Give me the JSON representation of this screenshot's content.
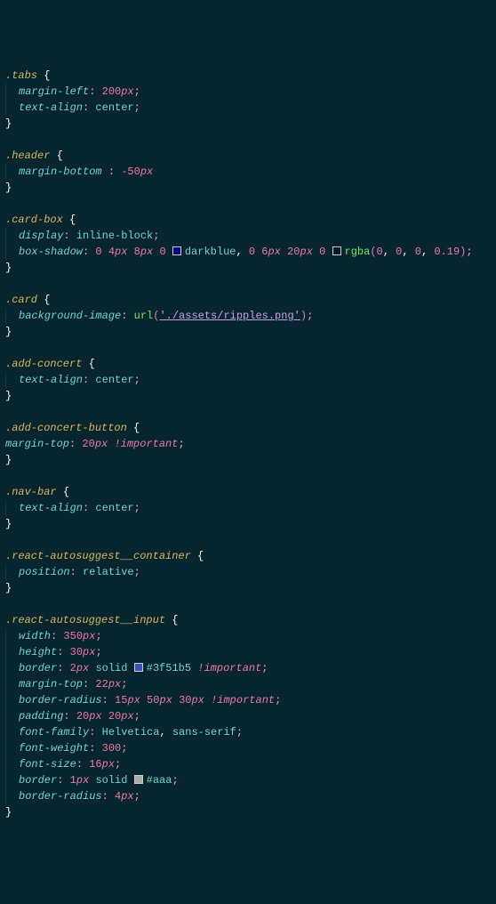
{
  "code": {
    "rules": [
      {
        "selector": ".tabs",
        "declarations": [
          {
            "prop": "margin-left",
            "tokens": [
              {
                "t": "num",
                "v": "200"
              },
              {
                "t": "unit",
                "v": "px"
              }
            ],
            "semi": true
          },
          {
            "prop": "text-align",
            "tokens": [
              {
                "t": "ident",
                "v": "center"
              }
            ],
            "semi": true
          }
        ]
      },
      {
        "selector": ".header",
        "declarations": [
          {
            "prop": "margin-bottom ",
            "tokens": [
              {
                "t": "num",
                "v": "-50"
              },
              {
                "t": "unit",
                "v": "px"
              }
            ],
            "semi": false
          }
        ]
      },
      {
        "selector": ".card-box",
        "declarations": [
          {
            "prop": "display",
            "tokens": [
              {
                "t": "ident",
                "v": "inline-block"
              }
            ],
            "semi": true
          },
          {
            "prop": "box-shadow",
            "tokens": [
              {
                "t": "num",
                "v": "0"
              },
              {
                "t": "sp"
              },
              {
                "t": "num",
                "v": "4"
              },
              {
                "t": "unit",
                "v": "px"
              },
              {
                "t": "sp"
              },
              {
                "t": "num",
                "v": "8"
              },
              {
                "t": "unit",
                "v": "px"
              },
              {
                "t": "sp"
              },
              {
                "t": "num",
                "v": "0"
              },
              {
                "t": "sp"
              },
              {
                "t": "swatch",
                "c": "#00008b"
              },
              {
                "t": "ident",
                "v": "darkblue"
              },
              {
                "t": "comma",
                "v": ","
              },
              {
                "t": "sp"
              },
              {
                "t": "num",
                "v": "0"
              },
              {
                "t": "sp"
              },
              {
                "t": "num",
                "v": "6"
              },
              {
                "t": "unit",
                "v": "px"
              },
              {
                "t": "sp"
              },
              {
                "t": "num",
                "v": "20"
              },
              {
                "t": "unit",
                "v": "px"
              },
              {
                "t": "sp"
              },
              {
                "t": "num",
                "v": "0"
              },
              {
                "t": "sp"
              },
              {
                "t": "swatch",
                "c": "rgba(0,0,0,0.19)"
              },
              {
                "t": "func",
                "v": "rgba"
              },
              {
                "t": "paren",
                "v": "("
              },
              {
                "t": "num",
                "v": "0"
              },
              {
                "t": "comma",
                "v": ","
              },
              {
                "t": "sp"
              },
              {
                "t": "num",
                "v": "0"
              },
              {
                "t": "comma",
                "v": ","
              },
              {
                "t": "sp"
              },
              {
                "t": "num",
                "v": "0"
              },
              {
                "t": "comma",
                "v": ","
              },
              {
                "t": "sp"
              },
              {
                "t": "num",
                "v": "0.19"
              },
              {
                "t": "paren",
                "v": ")"
              }
            ],
            "semi": true
          }
        ]
      },
      {
        "selector": ".card",
        "declarations": [
          {
            "prop": "background-image",
            "tokens": [
              {
                "t": "func",
                "v": "url"
              },
              {
                "t": "paren",
                "v": "("
              },
              {
                "t": "str",
                "v": "'./assets/ripples.png'",
                "u": true
              },
              {
                "t": "paren",
                "v": ")"
              }
            ],
            "semi": true
          }
        ]
      },
      {
        "selector": ".add-concert",
        "declarations": [
          {
            "prop": "text-align",
            "tokens": [
              {
                "t": "ident",
                "v": "center"
              }
            ],
            "semi": true
          }
        ]
      },
      {
        "selector": ".add-concert-button",
        "declarations": [
          {
            "prop": "margin-top",
            "noindent": true,
            "tokens": [
              {
                "t": "num",
                "v": "20"
              },
              {
                "t": "unit",
                "v": "px"
              },
              {
                "t": "sp"
              },
              {
                "t": "important",
                "v": "!important"
              }
            ],
            "semi": true
          }
        ]
      },
      {
        "selector": ".nav-bar",
        "declarations": [
          {
            "prop": "text-align",
            "tokens": [
              {
                "t": "ident",
                "v": "center"
              }
            ],
            "semi": true
          }
        ]
      },
      {
        "selector": ".react-autosuggest__container",
        "declarations": [
          {
            "prop": "position",
            "tokens": [
              {
                "t": "ident",
                "v": "relative"
              }
            ],
            "semi": true
          }
        ]
      },
      {
        "selector": ".react-autosuggest__input",
        "declarations": [
          {
            "prop": "width",
            "tokens": [
              {
                "t": "num",
                "v": "350"
              },
              {
                "t": "unit",
                "v": "px"
              }
            ],
            "semi": true
          },
          {
            "prop": "height",
            "tokens": [
              {
                "t": "num",
                "v": "30"
              },
              {
                "t": "unit",
                "v": "px"
              }
            ],
            "semi": true
          },
          {
            "prop": "border",
            "tokens": [
              {
                "t": "num",
                "v": "2"
              },
              {
                "t": "unit",
                "v": "px"
              },
              {
                "t": "sp"
              },
              {
                "t": "ident",
                "v": "solid"
              },
              {
                "t": "sp"
              },
              {
                "t": "swatch",
                "c": "#3f51b5"
              },
              {
                "t": "ident",
                "v": "#3f51b5"
              },
              {
                "t": "sp"
              },
              {
                "t": "important",
                "v": "!important"
              }
            ],
            "semi": true
          },
          {
            "prop": "margin-top",
            "tokens": [
              {
                "t": "num",
                "v": "22"
              },
              {
                "t": "unit",
                "v": "px"
              }
            ],
            "semi": true
          },
          {
            "prop": "border-radius",
            "tokens": [
              {
                "t": "num",
                "v": "15"
              },
              {
                "t": "unit",
                "v": "px"
              },
              {
                "t": "sp"
              },
              {
                "t": "num",
                "v": "50"
              },
              {
                "t": "unit",
                "v": "px"
              },
              {
                "t": "sp"
              },
              {
                "t": "num",
                "v": "30"
              },
              {
                "t": "unit",
                "v": "px"
              },
              {
                "t": "sp"
              },
              {
                "t": "important",
                "v": "!important"
              }
            ],
            "semi": true
          },
          {
            "prop": "padding",
            "tokens": [
              {
                "t": "num",
                "v": "20"
              },
              {
                "t": "unit",
                "v": "px"
              },
              {
                "t": "sp"
              },
              {
                "t": "num",
                "v": "20"
              },
              {
                "t": "unit",
                "v": "px"
              }
            ],
            "semi": true
          },
          {
            "prop": "font-family",
            "tokens": [
              {
                "t": "ident",
                "v": "Helvetica"
              },
              {
                "t": "comma",
                "v": ","
              },
              {
                "t": "sp"
              },
              {
                "t": "ident",
                "v": "sans-serif"
              }
            ],
            "semi": true
          },
          {
            "prop": "font-weight",
            "tokens": [
              {
                "t": "num",
                "v": "300"
              }
            ],
            "semi": true
          },
          {
            "prop": "font-size",
            "tokens": [
              {
                "t": "num",
                "v": "16"
              },
              {
                "t": "unit",
                "v": "px"
              }
            ],
            "semi": true
          },
          {
            "prop": "border",
            "tokens": [
              {
                "t": "num",
                "v": "1"
              },
              {
                "t": "unit",
                "v": "px"
              },
              {
                "t": "sp"
              },
              {
                "t": "ident",
                "v": "solid"
              },
              {
                "t": "sp"
              },
              {
                "t": "swatch",
                "c": "#aaa"
              },
              {
                "t": "ident",
                "v": "#aaa"
              }
            ],
            "semi": true
          },
          {
            "prop": "border-radius",
            "tokens": [
              {
                "t": "num",
                "v": "4"
              },
              {
                "t": "unit",
                "v": "px"
              }
            ],
            "semi": true
          }
        ]
      }
    ]
  }
}
